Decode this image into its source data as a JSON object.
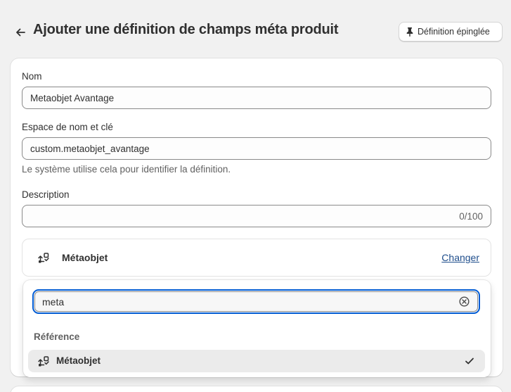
{
  "header": {
    "title": "Ajouter une définition de champs méta produit",
    "pin_button_label": "Définition épinglée"
  },
  "form": {
    "name": {
      "label": "Nom",
      "value": "Metaobjet Avantage"
    },
    "namespace": {
      "label": "Espace de nom et clé",
      "value": "custom.metaobjet_avantage",
      "help": "Le système utilise cela pour identifier la définition."
    },
    "description": {
      "label": "Description",
      "value": "",
      "counter": "0/100"
    },
    "type": {
      "name": "Métaobjet",
      "change_label": "Changer",
      "icon": "metaobject-icon"
    }
  },
  "dropdown": {
    "search_value": "meta",
    "section_heading": "Référence",
    "options": [
      {
        "label": "Métaobjet",
        "icon": "metaobject-icon",
        "selected": true
      }
    ]
  },
  "colors": {
    "background": "#f1f1f1",
    "card": "#ffffff",
    "focus": "#005bd3",
    "link": "#1f4e8c",
    "selected_option": "#ebebeb"
  }
}
